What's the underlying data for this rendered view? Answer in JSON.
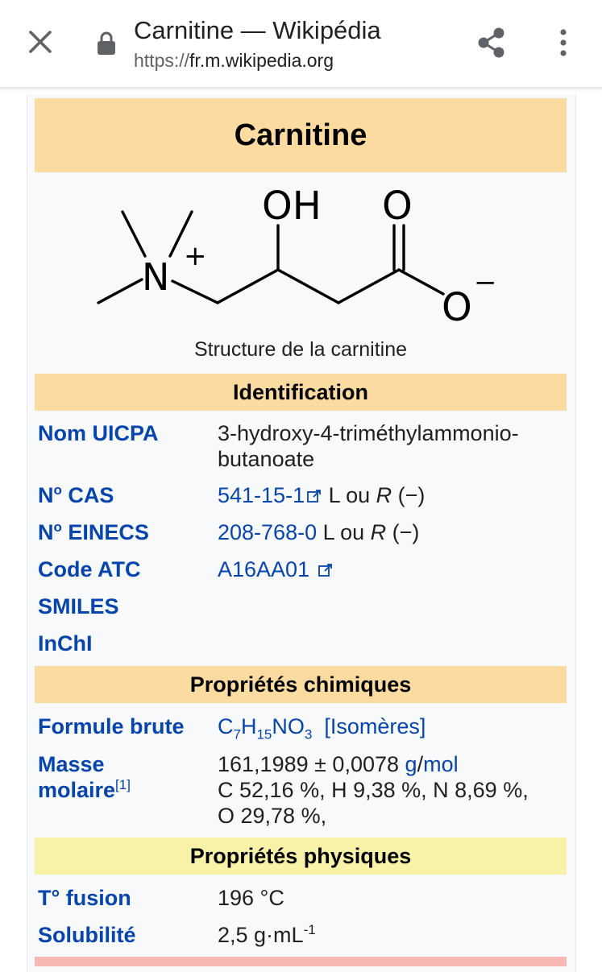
{
  "browser": {
    "title": "Carnitine — Wikipédia",
    "url_scheme": "https://",
    "url_domain": "fr.m.wikipedia.org"
  },
  "infobox": {
    "title": "Carnitine",
    "image": {
      "label_oh": "OH",
      "label_o": "O",
      "label_n": "N",
      "label_plus": "+",
      "label_o_minus": "O",
      "label_minus": "−"
    },
    "caption": "Structure de la carnitine",
    "sections": {
      "identification": "Identification",
      "chemical": "Propriétés chimiques",
      "physical": "Propriétés physiques"
    },
    "identification": {
      "iupac_label": "Nom UICPA",
      "iupac_value_line1": "3-hydroxy-4-triméthylammonio-",
      "iupac_value_line2": "butanoate",
      "cas_label": "No CAS",
      "cas_no_sup": "o",
      "cas_link": "541-15-1",
      "cas_note_prefix": " L ou ",
      "cas_note_r": "R",
      "cas_note_suffix": " (−)",
      "einecs_label": "No EINECS",
      "einecs_link": "208-768-0",
      "einecs_note_prefix": " L ou ",
      "einecs_note_r": "R",
      "einecs_note_suffix": " (−)",
      "atc_label": "Code ATC",
      "atc_link": "A16AA01",
      "smiles_label": "SMILES",
      "inchi_label": "InChI"
    },
    "chemical": {
      "formula_label": "Formule brute",
      "formula_parts": [
        "C",
        "7",
        "H",
        "15",
        "NO",
        "3"
      ],
      "isomers_link": "[Isomères]",
      "mass_label_line1": "Masse",
      "mass_label_line2": "molaire",
      "mass_ref": "[1]",
      "mass_value": "161,1989 ± 0,0078 ",
      "mass_unit_g": "g",
      "mass_unit_sep": "/",
      "mass_unit_mol": "mol",
      "composition_line1": "C 52,16 %, H 9,38 %, N 8,69 %,",
      "composition_line2": "O 29,78 %,"
    },
    "physical": {
      "fusion_label": "T° fusion",
      "fusion_value": "196 °C",
      "solubility_label": "Solubilité",
      "solubility_value": "2,5 g·mL",
      "solubility_exp": "-1"
    }
  },
  "colors": {
    "header_orange": "#fcdba0",
    "header_yellow": "#f8f1a8",
    "header_red": "#f7b8b5",
    "link": "#0645ad"
  }
}
